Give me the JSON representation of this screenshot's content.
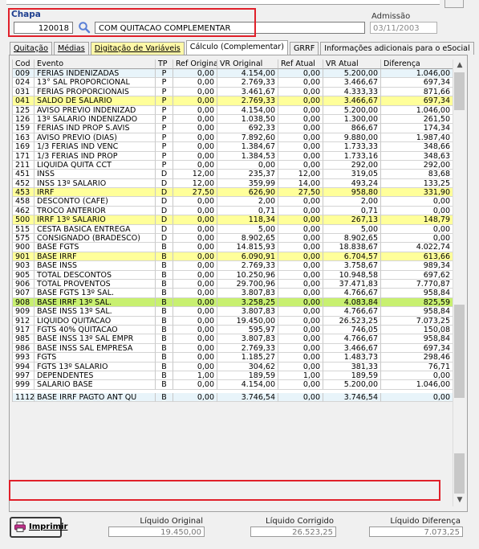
{
  "header": {
    "chapa_label": "Chapa",
    "chapa_code": "120018",
    "employee_name": "COM QUITACAO COMPLEMENTAR",
    "admissao_label": "Admissão",
    "admissao_value": "03/11/2003"
  },
  "tabs": [
    {
      "label": "Quitação"
    },
    {
      "label": "Médias"
    },
    {
      "label": "Digitação de Variáveis"
    },
    {
      "label": "Cálculo (Complementar)"
    },
    {
      "label": "GRRF"
    },
    {
      "label": "Informações adicionais para o eSocial"
    }
  ],
  "grid": {
    "columns": [
      "Cod",
      "Evento",
      "TP",
      "Ref Original",
      "VR Original",
      "Ref Atual",
      "VR Atual",
      "Diferença"
    ],
    "rows": [
      {
        "c": [
          "009",
          "FERIAS INDENIZADAS",
          "P",
          "0,00",
          "4.154,00",
          "0,00",
          "5.200,00",
          "1.046,00"
        ],
        "hl": "blue"
      },
      {
        "c": [
          "024",
          "13° SAL PROPORCIONAL",
          "P",
          "0,00",
          "2.769,33",
          "0,00",
          "3.466,67",
          "697,34"
        ]
      },
      {
        "c": [
          "031",
          "FERIAS PROPORCIONAIS",
          "P",
          "0,00",
          "3.461,67",
          "0,00",
          "4.333,33",
          "871,66"
        ]
      },
      {
        "c": [
          "041",
          "SALDO DE SALARIO",
          "P",
          "0,00",
          "2.769,33",
          "0,00",
          "3.466,67",
          "697,34"
        ],
        "hl": "yellow"
      },
      {
        "c": [
          "125",
          "AVISO PREVIO INDENIZAD",
          "P",
          "0,00",
          "4.154,00",
          "0,00",
          "5.200,00",
          "1.046,00"
        ]
      },
      {
        "c": [
          "126",
          "13º SALARIO INDENIZADO",
          "P",
          "0,00",
          "1.038,50",
          "0,00",
          "1.300,00",
          "261,50"
        ]
      },
      {
        "c": [
          "159",
          "FERIAS IND PROP S.AVIS",
          "P",
          "0,00",
          "692,33",
          "0,00",
          "866,67",
          "174,34"
        ]
      },
      {
        "c": [
          "163",
          "AVISO PREVIO (DIAS)",
          "P",
          "0,00",
          "7.892,60",
          "0,00",
          "9.880,00",
          "1.987,40"
        ]
      },
      {
        "c": [
          "169",
          "1/3 FERIAS IND VENC",
          "P",
          "0,00",
          "1.384,67",
          "0,00",
          "1.733,33",
          "348,66"
        ]
      },
      {
        "c": [
          "171",
          "1/3 FERIAS IND PROP",
          "P",
          "0,00",
          "1.384,53",
          "0,00",
          "1.733,16",
          "348,63"
        ]
      },
      {
        "c": [
          "211",
          "LIQUIDA QUITA CCT",
          "P",
          "0,00",
          "0,00",
          "0,00",
          "292,00",
          "292,00"
        ]
      },
      {
        "c": [
          "451",
          "INSS",
          "D",
          "12,00",
          "235,37",
          "12,00",
          "319,05",
          "83,68"
        ]
      },
      {
        "c": [
          "452",
          "INSS 13º SALARIO",
          "D",
          "12,00",
          "359,99",
          "14,00",
          "493,24",
          "133,25"
        ]
      },
      {
        "c": [
          "453",
          "IRRF",
          "D",
          "27,50",
          "626,90",
          "27,50",
          "958,80",
          "331,90"
        ],
        "hl": "yellow"
      },
      {
        "c": [
          "458",
          "DESCONTO (CAFE)",
          "D",
          "0,00",
          "2,00",
          "0,00",
          "2,00",
          "0,00"
        ]
      },
      {
        "c": [
          "462",
          "TROCO ANTERIOR",
          "D",
          "0,00",
          "0,71",
          "0,00",
          "0,71",
          "0,00"
        ]
      },
      {
        "c": [
          "500",
          "IRRF 13º SALARIO",
          "D",
          "0,00",
          "118,34",
          "0,00",
          "267,13",
          "148,79"
        ],
        "hl": "yellow"
      },
      {
        "c": [
          "515",
          "CESTA BASICA ENTREGA",
          "D",
          "0,00",
          "5,00",
          "0,00",
          "5,00",
          "0,00"
        ]
      },
      {
        "c": [
          "575",
          "CONSIGNADO (BRADESCO)",
          "D",
          "0,00",
          "8.902,65",
          "0,00",
          "8.902,65",
          "0,00"
        ]
      },
      {
        "c": [
          "900",
          "BASE FGTS",
          "B",
          "0,00",
          "14.815,93",
          "0,00",
          "18.838,67",
          "4.022,74"
        ]
      },
      {
        "c": [
          "901",
          "BASE IRRF",
          "B",
          "0,00",
          "6.090,91",
          "0,00",
          "6.704,57",
          "613,66"
        ],
        "hl": "yellow"
      },
      {
        "c": [
          "903",
          "BASE INSS",
          "B",
          "0,00",
          "2.769,33",
          "0,00",
          "3.758,67",
          "989,34"
        ]
      },
      {
        "c": [
          "905",
          "TOTAL DESCONTOS",
          "B",
          "0,00",
          "10.250,96",
          "0,00",
          "10.948,58",
          "697,62"
        ]
      },
      {
        "c": [
          "906",
          "TOTAL PROVENTOS",
          "B",
          "0,00",
          "29.700,96",
          "0,00",
          "37.471,83",
          "7.770,87"
        ]
      },
      {
        "c": [
          "907",
          "BASE FGTS 13º SAL.",
          "B",
          "0,00",
          "3.807,83",
          "0,00",
          "4.766,67",
          "958,84"
        ]
      },
      {
        "c": [
          "908",
          "BASE IRRF 13º SAL.",
          "B",
          "0,00",
          "3.258,25",
          "0,00",
          "4.083,84",
          "825,59"
        ],
        "hl": "green"
      },
      {
        "c": [
          "909",
          "BASE INSS 13º SAL.",
          "B",
          "0,00",
          "3.807,83",
          "0,00",
          "4.766,67",
          "958,84"
        ]
      },
      {
        "c": [
          "912",
          "LIQUIDO QUITACAO",
          "B",
          "0,00",
          "19.450,00",
          "0,00",
          "26.523,25",
          "7.073,25"
        ]
      },
      {
        "c": [
          "917",
          "FGTS 40% QUITACAO",
          "B",
          "0,00",
          "595,97",
          "0,00",
          "746,05",
          "150,08"
        ]
      },
      {
        "c": [
          "985",
          "BASE INSS 13º SAL EMPR",
          "B",
          "0,00",
          "3.807,83",
          "0,00",
          "4.766,67",
          "958,84"
        ]
      },
      {
        "c": [
          "986",
          "BASE INSS SAL EMPRESA",
          "B",
          "0,00",
          "2.769,33",
          "0,00",
          "3.466,67",
          "697,34"
        ]
      },
      {
        "c": [
          "993",
          "FGTS",
          "B",
          "0,00",
          "1.185,27",
          "0,00",
          "1.483,73",
          "298,46"
        ]
      },
      {
        "c": [
          "994",
          "FGTS 13º SALARIO",
          "B",
          "0,00",
          "304,62",
          "0,00",
          "381,33",
          "76,71"
        ]
      },
      {
        "c": [
          "997",
          "DEPENDENTES",
          "B",
          "1,00",
          "189,59",
          "1,00",
          "189,59",
          "0,00"
        ]
      },
      {
        "c": [
          "999",
          "SALARIO BASE",
          "B",
          "0,00",
          "4.154,00",
          "0,00",
          "5.200,00",
          "1.046,00"
        ]
      },
      {
        "c": [
          "1112",
          "BASE IRRF PAGTO ANT QU",
          "B",
          "0,00",
          "3.746,54",
          "0,00",
          "3.746,54",
          "0,00"
        ],
        "hl": "blue"
      }
    ]
  },
  "footer": {
    "print_label": "Imprimir",
    "liquido_original_label": "Líquido Original",
    "liquido_original_value": "19.450,00",
    "liquido_corrigido_label": "Líquido Corrigido",
    "liquido_corrigido_value": "26.523,25",
    "liquido_diferenca_label": "Líquido Diferença",
    "liquido_diferenca_value": "7.073,25"
  },
  "colors": {
    "highlight_yellow": "#ffff9a",
    "highlight_green": "#c8f070",
    "selected_row_blue": "#e8f4fa",
    "annotation_red": "#e0202a"
  }
}
